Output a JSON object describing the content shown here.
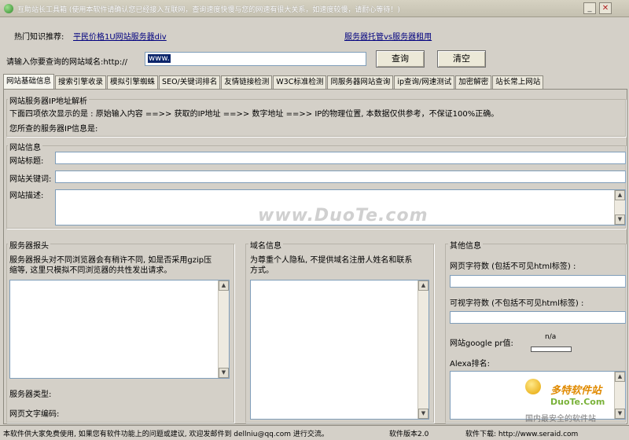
{
  "window": {
    "title": "互助站长工具箱 (使用本软件请确认您已经接入互联网，查询速度快慢与您的网速有很大关系，如速度较慢，请耐心等待！)",
    "minimize": "_",
    "close": "✕"
  },
  "header": {
    "hot_label": "热门知识推荐:",
    "hot_link1": "平民价格1U网站服务器div",
    "hot_link2": "服务器托管vs服务器租用",
    "domain_label": "请输入你要查询的网站域名:http://",
    "domain_value": "www.",
    "query_button": "查询",
    "clear_button": "清空"
  },
  "tabs": [
    "网站基础信息",
    "搜索引擎收录",
    "模拟引擎蜘蛛",
    "SEO/关键词排名",
    "友情链接检测",
    "W3C标准检测",
    "同服务器网站查询",
    "ip查询/网速测试",
    "加密解密",
    "站长常上网站"
  ],
  "ip_section": {
    "title": "网站服务器IP地址解析",
    "description": "下面四项依次显示的是 : 原始输入内容 ==>> 获取的IP地址 ==>> 数字地址 ==>> IP的物理位置, 本数据仅供参考，不保证100%正确。",
    "your_ip": "您所查的服务器IP信息是:"
  },
  "site_info": {
    "title": "网站信息",
    "site_title_label": "网站标题:",
    "keywords_label": "网站关键词:",
    "description_label": "网站描述:"
  },
  "server_header": {
    "title": "服务器报头",
    "desc_line1": "服务器报头对不同浏览器会有稍许不同, 如是否采用gzip压",
    "desc_line2": "缩等, 这里只模拟不同浏览器的共性发出请求。",
    "server_type": "服务器类型:",
    "encoding": "网页文字编码:"
  },
  "domain_info": {
    "title": "域名信息",
    "desc_line1": "为尊重个人隐私, 不提供域名注册人姓名和联系",
    "desc_line2": "方式。"
  },
  "other_info": {
    "title": "其他信息",
    "chars_label": "网页字符数 (包括不可见html标签) :",
    "visible_chars_label": "可视字符数 (不包括不可见html标签) :",
    "pr_label": "网站google pr值:",
    "pr_value": "n/a",
    "alexa_label": "Alexa排名:"
  },
  "status_bar": {
    "free": "本软件供大家免费使用, 如果您有软件功能上的问题或建议, 欢迎发邮件到 dellniu@qq.com 进行交流。",
    "version": "软件版本2.0",
    "download": "软件下载: http://www.seraid.com"
  },
  "watermarks": {
    "center": "www.DuoTe.com",
    "corner_brand": "多特软件站",
    "corner_url": "DuoTe.Com",
    "corner_slogan": "国内最安全的软件站"
  }
}
